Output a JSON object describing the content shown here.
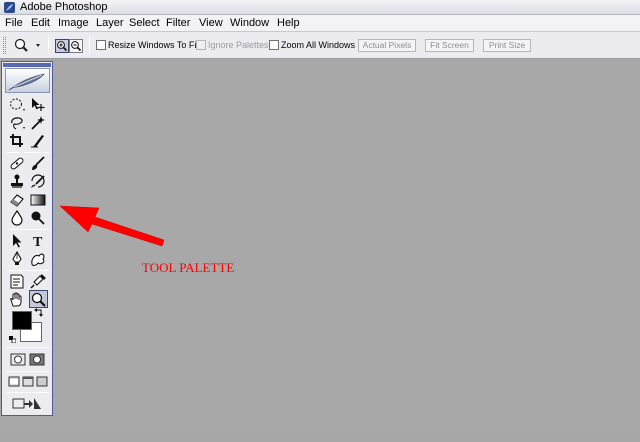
{
  "window": {
    "title": "Adobe Photoshop",
    "app_icon": "photoshop-feather-icon"
  },
  "menubar": {
    "items": [
      "File",
      "Edit",
      "Image",
      "Layer",
      "Select",
      "Filter",
      "View",
      "Window",
      "Help"
    ]
  },
  "options_bar": {
    "tool_icon": "zoom-tool-icon",
    "zoom_in_icon": "zoom-in-icon",
    "zoom_out_icon": "zoom-out-icon",
    "checkboxes": [
      {
        "label": "Resize Windows To Fit",
        "checked": false,
        "enabled": true
      },
      {
        "label": "Ignore Palettes",
        "checked": false,
        "enabled": false
      },
      {
        "label": "Zoom All Windows",
        "checked": false,
        "enabled": true
      }
    ],
    "buttons": [
      "Actual Pixels",
      "Fit Screen",
      "Print Size"
    ]
  },
  "tool_palette": {
    "tools": [
      [
        "marquee-tool-icon",
        "move-tool-icon"
      ],
      [
        "lasso-tool-icon",
        "magic-wand-tool-icon"
      ],
      [
        "crop-tool-icon",
        "slice-tool-icon"
      ],
      [
        "healing-brush-tool-icon",
        "brush-tool-icon"
      ],
      [
        "clone-stamp-tool-icon",
        "history-brush-tool-icon"
      ],
      [
        "eraser-tool-icon",
        "gradient-tool-icon"
      ],
      [
        "blur-tool-icon",
        "dodge-tool-icon"
      ],
      [
        "path-selection-tool-icon",
        "type-tool-icon"
      ],
      [
        "pen-tool-icon",
        "custom-shape-tool-icon"
      ],
      [
        "notes-tool-icon",
        "eyedropper-tool-icon"
      ],
      [
        "hand-tool-icon",
        "zoom-tool-icon"
      ]
    ],
    "selected_tool": "zoom-tool-icon",
    "foreground_color": "#000000",
    "background_color": "#ffffff",
    "modes": [
      "standard-mode-icon",
      "quick-mask-mode-icon"
    ],
    "screen_modes": [
      "standard-screen-mode-icon",
      "full-screen-menu-mode-icon",
      "full-screen-mode-icon"
    ],
    "jump_to": "jump-to-imageready-icon",
    "type_glyph": "T"
  },
  "annotation": {
    "text": "TOOL PALETTE",
    "color": "#ff0000"
  },
  "canvas": {
    "background": "#a8a8a8"
  }
}
